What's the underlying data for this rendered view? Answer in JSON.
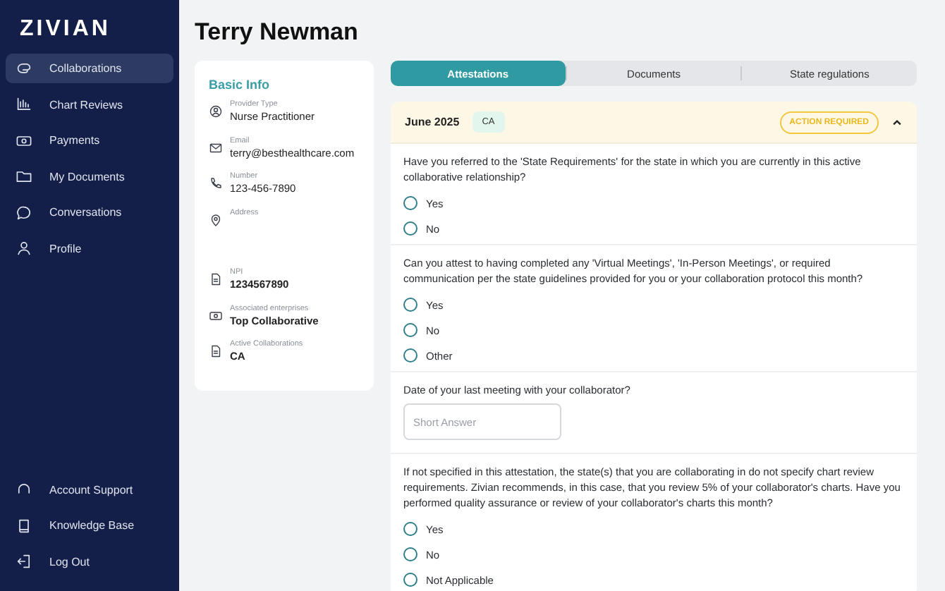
{
  "sidebar": {
    "logo": "ZIVIAN",
    "items": [
      {
        "label": "Collaborations",
        "selected": true
      },
      {
        "label": "Chart Reviews",
        "selected": false
      },
      {
        "label": "Payments",
        "selected": false
      },
      {
        "label": "My Documents",
        "selected": false
      },
      {
        "label": "Conversations",
        "selected": false
      },
      {
        "label": "Profile",
        "selected": false
      }
    ],
    "bottom_items": [
      {
        "label": "Account Support"
      },
      {
        "label": "Knowledge Base"
      },
      {
        "label": "Log Out"
      }
    ]
  },
  "page_title": "Terry Newman",
  "basic_info": {
    "title": "Basic Info",
    "fields": [
      {
        "label": "Provider Type",
        "value": "Nurse Practitioner"
      },
      {
        "label": "Email",
        "value": "terry@besthealthcare.com"
      },
      {
        "label": "Number",
        "value": "123-456-7890"
      },
      {
        "label": "Address"
      },
      {
        "label": "NPI",
        "value": "1234567890"
      },
      {
        "label": "Associated enterprises",
        "value": "Top Collaborative"
      },
      {
        "label": "Active Collaborations",
        "value": "CA"
      }
    ]
  },
  "tabs": [
    {
      "label": "Attestations",
      "selected": true
    },
    {
      "label": "Documents",
      "selected": false
    },
    {
      "label": "State regulations",
      "selected": false
    }
  ],
  "attestation": {
    "month": "June 2025",
    "state": "CA",
    "status": "ACTION REQUIRED",
    "expanded": true,
    "questions": [
      {
        "kind": "radio",
        "text": "Have you referred to the 'State Requirements' for the state in which you are currently in this active collaborative relationship?",
        "options": [
          {
            "label": "Yes",
            "selected": false
          },
          {
            "label": "No",
            "selected": false
          }
        ]
      },
      {
        "kind": "radio",
        "text": "Can you attest to having completed any 'Virtual Meetings', 'In-Person Meetings', or required communication per the state guidelines provided for you or your collaboration protocol this month?",
        "options": [
          {
            "label": "Yes",
            "selected": false
          },
          {
            "label": "No",
            "selected": false
          },
          {
            "label": "Other",
            "selected": false
          }
        ]
      },
      {
        "kind": "text",
        "text": "Date of your last meeting with your collaborator?",
        "placeholder": "Short Answer"
      },
      {
        "kind": "radio",
        "text": "If not specified in this attestation, the state(s) that you are collaborating in do not specify chart review requirements. Zivian recommends, in this case, that you review 5% of your collaborator's charts. Have you performed quality assurance or review of your collaborator's charts this month?",
        "options": [
          {
            "label": "Yes",
            "selected": false
          },
          {
            "label": "No",
            "selected": false
          },
          {
            "label": "Not Applicable",
            "selected": false
          }
        ]
      }
    ]
  }
}
